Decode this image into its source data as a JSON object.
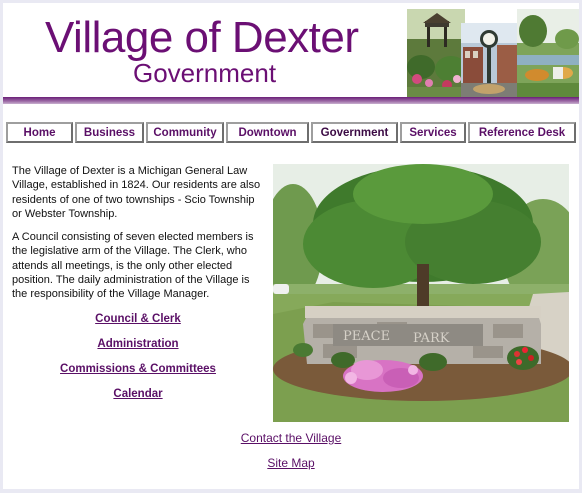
{
  "header": {
    "title": "Village of Dexter",
    "subtitle": "Government"
  },
  "nav": {
    "tabs": [
      {
        "label": "Home"
      },
      {
        "label": "Business"
      },
      {
        "label": "Community"
      },
      {
        "label": "Downtown"
      },
      {
        "label": "Government",
        "active": true
      },
      {
        "label": "Services"
      },
      {
        "label": "Reference Desk"
      }
    ]
  },
  "intro": {
    "paragraph_1": "The Village of Dexter is a Michigan General Law Village, established in 1824. Our residents are also residents of one of two townships - Scio Township or Webster Township.",
    "paragraph_2": "A Council consisting of seven elected members is the legislative arm of the Village. The Clerk, who attends all meetings, is the only other elected position. The daily administration of the Village is the responsibility of the Village Manager."
  },
  "links": [
    "Council & Clerk",
    "Administration",
    "Commissions & Committees",
    "Calendar"
  ],
  "photo": {
    "sign_words": [
      "PEACE",
      "PARK"
    ]
  },
  "footer": {
    "contact": "Contact the Village",
    "sitemap": "Site Map"
  },
  "colors": {
    "brand_purple": "#6b0f74",
    "link_purple": "#5a0f66"
  }
}
